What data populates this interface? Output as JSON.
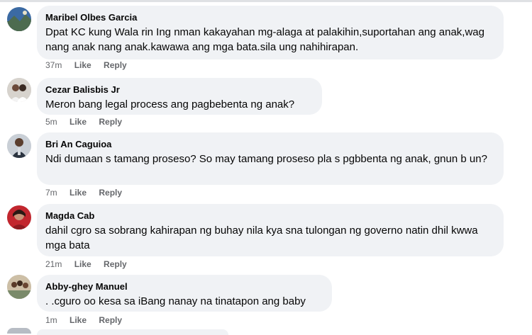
{
  "comments": [
    {
      "author": "Maribel Olbes Garcia",
      "text": "Dpat KC kung Wala rin Ing nman kakayahan mg-alaga at palakihin,suportahan ang anak,wag nang anak nang anak.kawawa ang mga bata.sila ung nahihirapan.",
      "time": "37m",
      "like": "Like",
      "reply": "Reply",
      "avatar": "avatar-photo-landscape"
    },
    {
      "author": "Cezar Balisbis Jr",
      "text": "Meron bang legal process ang pagbebenta ng anak?",
      "time": "5m",
      "like": "Like",
      "reply": "Reply",
      "avatar": "avatar-photo-couple"
    },
    {
      "author": "Bri An Caguioa",
      "text": "Ndi dumaan s tamang proseso? So may tamang proseso pla s pgbbenta ng anak, gnun b un?",
      "time": "7m",
      "like": "Like",
      "reply": "Reply",
      "avatar": "avatar-photo-man"
    },
    {
      "author": "Magda Cab",
      "text": "dahil cgro sa sobrang kahirapan ng buhay nila kya sna tulongan ng governo natin dhil kwwa mga bata",
      "time": "21m",
      "like": "Like",
      "reply": "Reply",
      "avatar": "avatar-photo-woman"
    },
    {
      "author": "Abby-ghey Manuel",
      "text": ". .cguro oo kesa sa iBang nanay na tinatapon ang baby",
      "time": "1m",
      "like": "Like",
      "reply": "Reply",
      "avatar": "avatar-photo-group"
    }
  ],
  "colors": {
    "bubble": "#f0f2f5",
    "text": "#050505",
    "meta": "#65676b"
  }
}
